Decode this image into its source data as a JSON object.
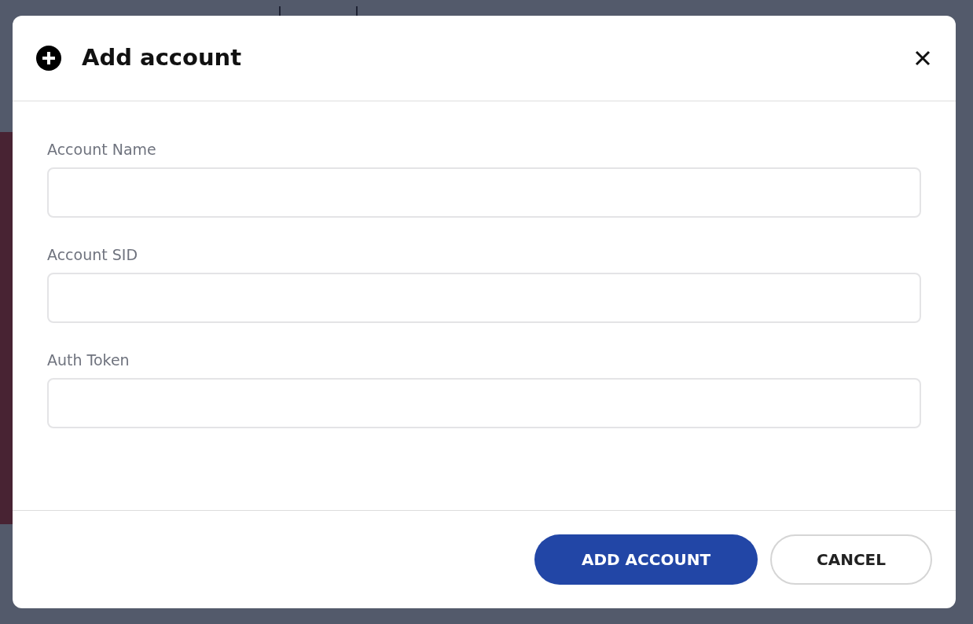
{
  "dialog": {
    "title": "Add account",
    "fields": [
      {
        "label": "Account Name"
      },
      {
        "label": "Account SID"
      },
      {
        "label": "Auth Token"
      }
    ],
    "buttons": [
      {
        "label": "ADD ACCOUNT",
        "kind": "primary"
      },
      {
        "label": "CANCEL",
        "kind": "secondary"
      }
    ]
  }
}
